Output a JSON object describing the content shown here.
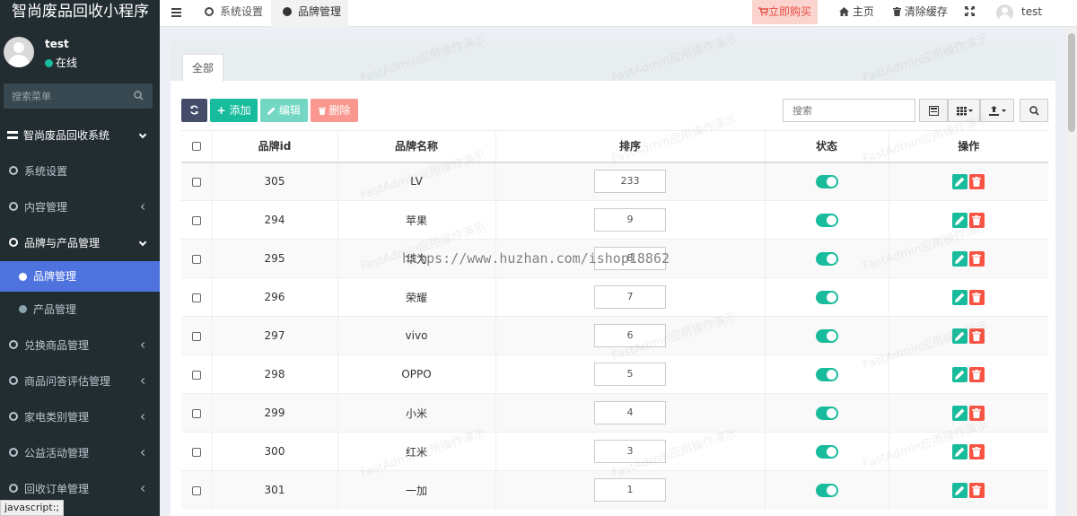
{
  "app": {
    "title": "智尚废品回收小程序"
  },
  "user": {
    "name": "test",
    "status": "在线"
  },
  "sidebar": {
    "search_placeholder": "搜索菜单",
    "items": [
      {
        "label": "智尚废品回收系统"
      },
      {
        "label": "系统设置"
      },
      {
        "label": "内容管理"
      },
      {
        "label": "品牌与产品管理"
      },
      {
        "label": "品牌管理"
      },
      {
        "label": "产品管理"
      },
      {
        "label": "兑换商品管理"
      },
      {
        "label": "商品问答评估管理"
      },
      {
        "label": "家电类别管理"
      },
      {
        "label": "公益活动管理"
      },
      {
        "label": "回收订单管理"
      }
    ]
  },
  "navbar": {
    "tabs": [
      {
        "label": "系统设置"
      },
      {
        "label": "品牌管理"
      }
    ],
    "buy_label": "立即购买",
    "home_label": "主页",
    "clear_cache_label": "清除缓存",
    "user_label": "test"
  },
  "panel": {
    "tab_label": "全部"
  },
  "toolbar": {
    "add_label": "添加",
    "edit_label": "编辑",
    "delete_label": "删除",
    "search_placeholder": "搜索"
  },
  "table": {
    "headers": {
      "id": "品牌id",
      "name": "品牌名称",
      "weigh": "排序",
      "status": "状态",
      "ops": "操作"
    },
    "rows": [
      {
        "id": "305",
        "name": "LV",
        "weigh": "233"
      },
      {
        "id": "294",
        "name": "苹果",
        "weigh": "9"
      },
      {
        "id": "295",
        "name": "华为",
        "weigh": "8"
      },
      {
        "id": "296",
        "name": "荣耀",
        "weigh": "7"
      },
      {
        "id": "297",
        "name": "vivo",
        "weigh": "6"
      },
      {
        "id": "298",
        "name": "OPPO",
        "weigh": "5"
      },
      {
        "id": "299",
        "name": "小米",
        "weigh": "4"
      },
      {
        "id": "300",
        "name": "红米",
        "weigh": "3"
      },
      {
        "id": "301",
        "name": "一加",
        "weigh": "1"
      }
    ]
  },
  "overlay": {
    "watermark": "FastAdmin应用操作演示",
    "url": "https://www.huzhan.com/ishop18862",
    "status_bar": "javascript:;"
  },
  "colors": {
    "sidebar_bg": "#222d32",
    "accent": "#4e73df",
    "success": "#18bc9c",
    "danger": "#f75444"
  }
}
